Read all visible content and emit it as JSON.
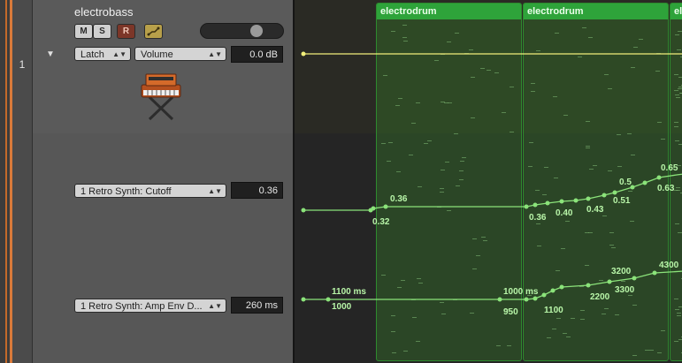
{
  "track": {
    "name": "electrobass",
    "number": "1",
    "mute_label": "M",
    "solo_label": "S",
    "record_label": "R",
    "automation_mode": "Latch",
    "automation_param": "Volume",
    "volume_value": "0.0 dB"
  },
  "lanes": [
    {
      "param": "1 Retro Synth: Cutoff",
      "value": "0.36"
    },
    {
      "param": "1 Retro Synth: Amp Env D...",
      "value": "260 ms"
    }
  ],
  "regions": [
    {
      "name": "electrodrum"
    },
    {
      "name": "electrodrum"
    },
    {
      "name": "ele"
    }
  ],
  "cutoff_points": [
    {
      "label": "0.36"
    },
    {
      "label": "0.32"
    },
    {
      "label": "0.36"
    },
    {
      "label": "0.40"
    },
    {
      "label": "0.43"
    },
    {
      "label": "0.51"
    },
    {
      "label": "0.5"
    },
    {
      "label": "0.63"
    },
    {
      "label": "0.65"
    }
  ],
  "ampenv_points": [
    {
      "label": "1100 ms"
    },
    {
      "label": "1000"
    },
    {
      "label": "1000 ms"
    },
    {
      "label": "950"
    },
    {
      "label": "1100"
    },
    {
      "label": "2200"
    },
    {
      "label": "3200"
    },
    {
      "label": "3300"
    },
    {
      "label": "4300"
    }
  ],
  "colors": {
    "region_header": "#2ea33a",
    "automation_line": "#8be37a",
    "volume_line": "#f2ef7a",
    "track_color": "#d97a3a"
  }
}
